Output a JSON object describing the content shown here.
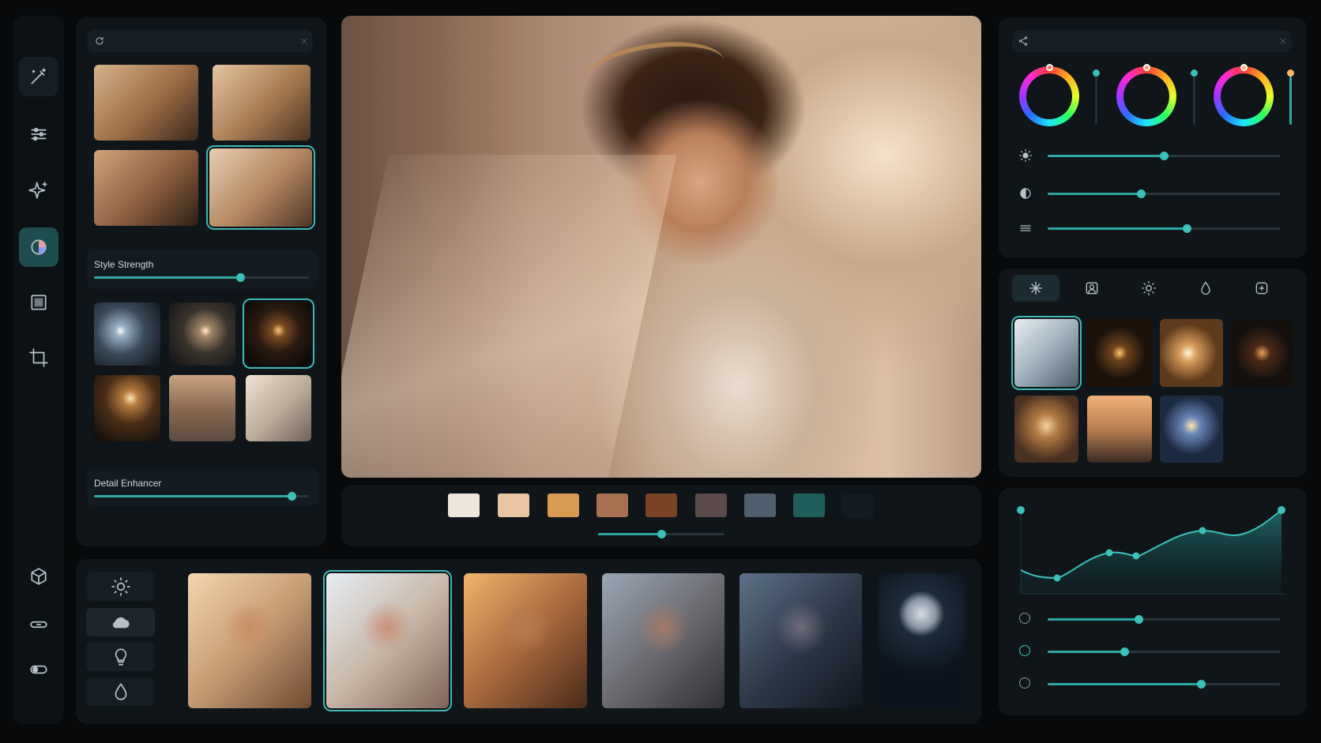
{
  "left_panel": {
    "style_strength_label": "Style Strength",
    "style_strength_value": 0.68,
    "detail_enhancer_label": "Detail Enhancer",
    "detail_enhancer_value": 0.92
  },
  "palette": {
    "colors": [
      "#eee6dc",
      "#e8c4a0",
      "#d99a52",
      "#a8714f",
      "#7a4326",
      "#5b4b4b",
      "#4f5e6c",
      "#1f5e5b",
      "#131b22"
    ],
    "slider_value": 0.5
  },
  "adjustments": {
    "sliders": [
      0.5,
      0.4,
      0.6
    ]
  },
  "curve": {
    "sliders": [
      0.39,
      0.33,
      0.66
    ]
  },
  "accent": "#2fa6a1"
}
